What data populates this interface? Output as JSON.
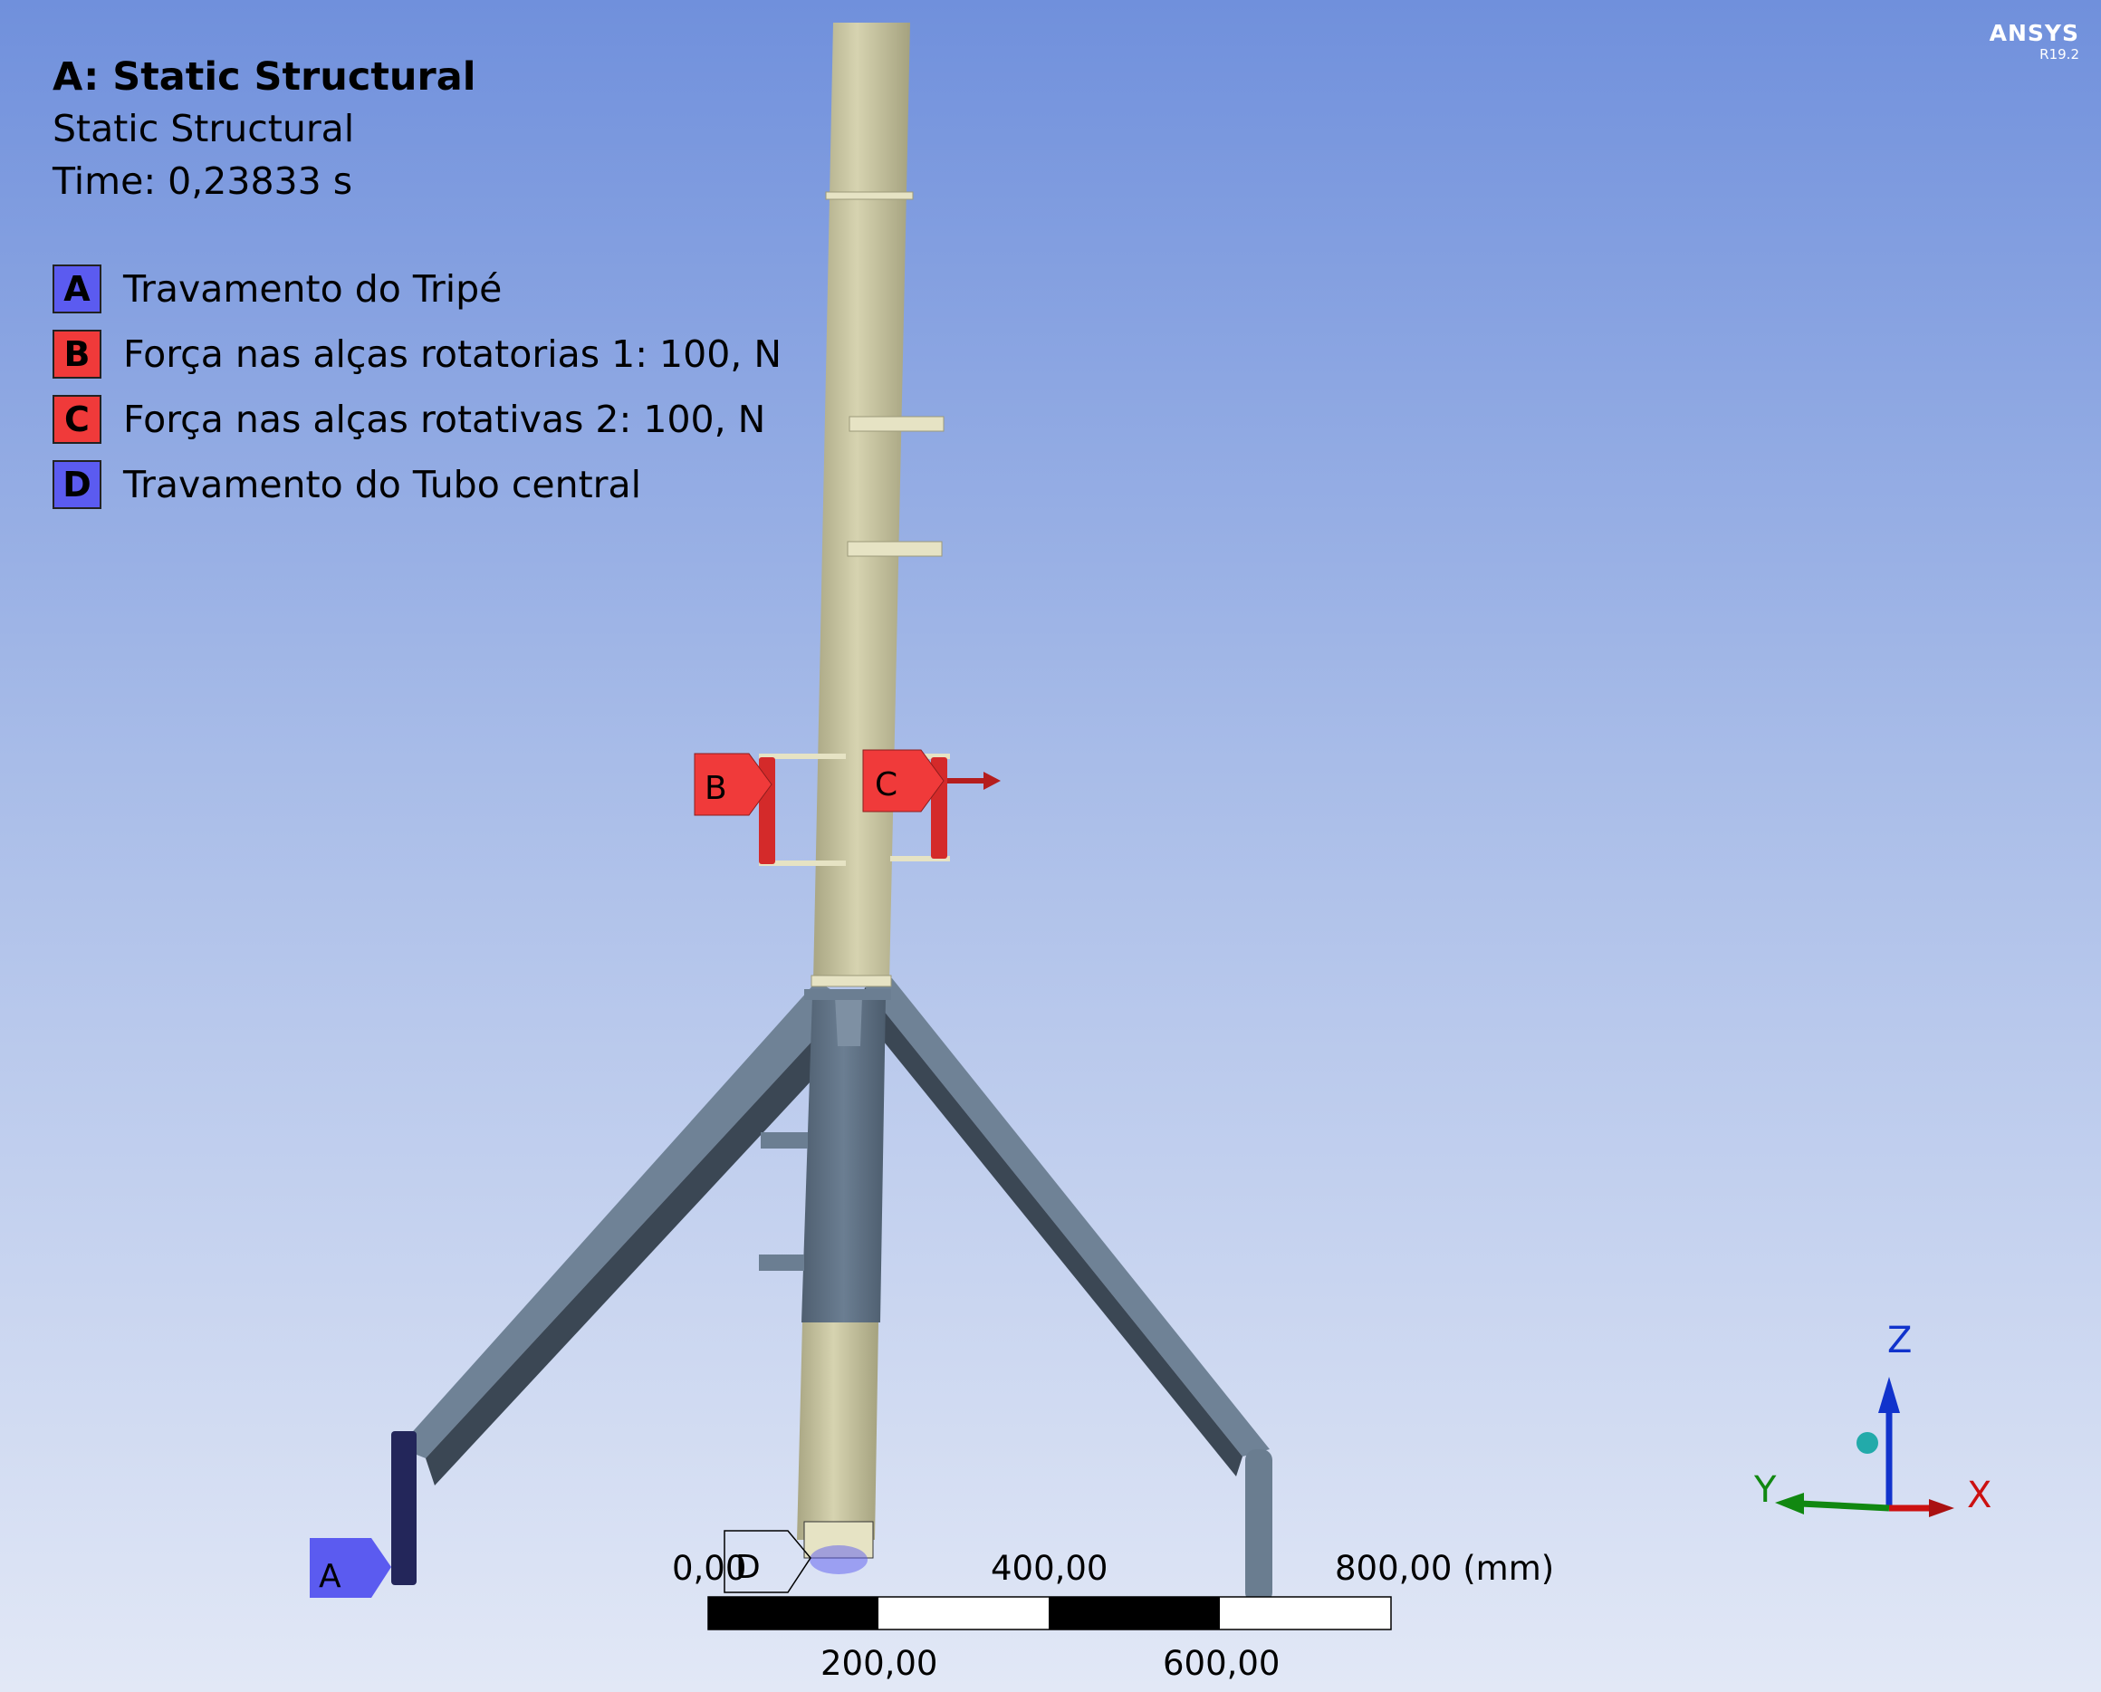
{
  "header": {
    "title": "A: Static Structural",
    "subtitle": "Static Structural",
    "time": "Time: 0,23833 s"
  },
  "legend": [
    {
      "letter": "A",
      "text": "Travamento do Tripé",
      "color": "#5b5bf0"
    },
    {
      "letter": "B",
      "text": "Força nas alças rotatorias 1: 100, N",
      "color": "#f03a3a"
    },
    {
      "letter": "C",
      "text": "Força nas alças rotativas 2: 100, N",
      "color": "#f03a3a"
    },
    {
      "letter": "D",
      "text": "Travamento do Tubo central",
      "color": "#5b5bf0"
    }
  ],
  "brand": {
    "name": "ANSYS",
    "version": "R19.2"
  },
  "markers": {
    "a": "A",
    "b": "B",
    "c": "C",
    "d": "D"
  },
  "scale": {
    "top": [
      "0,00",
      "400,00",
      "800,00 (mm)"
    ],
    "bottom": [
      "200,00",
      "600,00"
    ]
  },
  "triad": {
    "x": "X",
    "y": "Y",
    "z": "Z"
  },
  "colors": {
    "background_top": "#7090dc",
    "background_bottom": "#e2e8f6",
    "pole": "#c9c6a0",
    "tripod": "#5f7183",
    "support": "#5b5bf0",
    "force": "#f03a3a",
    "axis_x": "#cc1111",
    "axis_y": "#118811",
    "axis_z": "#1133cc"
  }
}
